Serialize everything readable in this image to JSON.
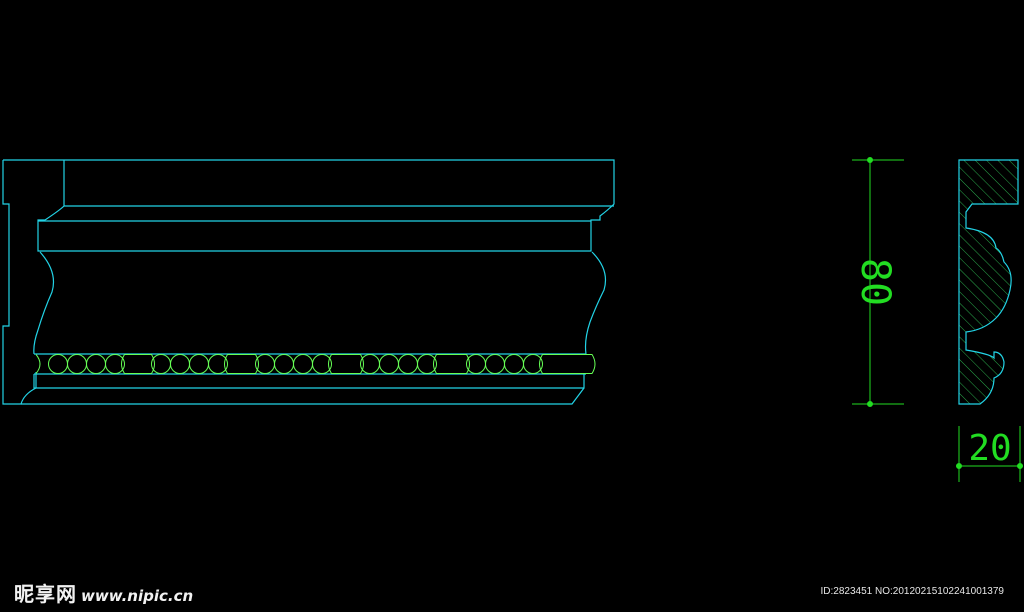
{
  "colors": {
    "background": "#000000",
    "outline": "#22d3e6",
    "bead_line": "#66ff55",
    "dimension": "#22dd22",
    "hatch": "#2aa84a"
  },
  "dimensions": {
    "height_label": "80",
    "width_label": "20"
  },
  "watermark": {
    "logo": "昵享网",
    "url": "www.nipic.cn",
    "id_text": "ID:2823451 NO:20120215102241001379"
  }
}
